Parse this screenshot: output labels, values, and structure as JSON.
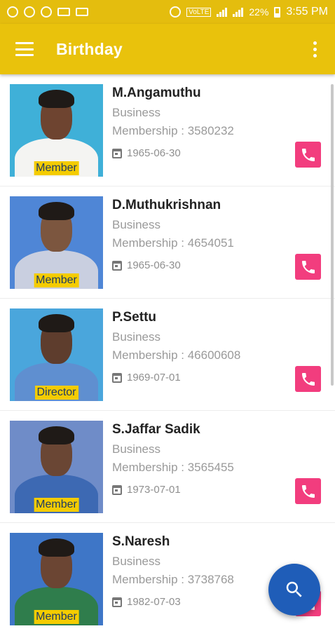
{
  "status_bar": {
    "battery": "22%",
    "time": "3:55 PM",
    "network": "VoLTE"
  },
  "app_bar": {
    "title": "Birthday",
    "menu_icon": "menu-icon",
    "overflow_icon": "more-vert-icon"
  },
  "colors": {
    "app_bar": "#e9c20c",
    "call_button": "#f23d7e",
    "fab": "#1f5db8",
    "role_tag": "#f4cc00"
  },
  "members": [
    {
      "name": "M.Angamuthu",
      "occupation": "Business",
      "membership": "Membership : 3580232",
      "dob": "1965-06-30",
      "role": "Member"
    },
    {
      "name": "D.Muthukrishnan",
      "occupation": "Business",
      "membership": "Membership : 4654051",
      "dob": "1965-06-30",
      "role": "Member"
    },
    {
      "name": "P.Settu",
      "occupation": "Business",
      "membership": "Membership : 46600608",
      "dob": "1969-07-01",
      "role": "Director"
    },
    {
      "name": "S.Jaffar Sadik",
      "occupation": "Business",
      "membership": "Membership : 3565455",
      "dob": "1973-07-01",
      "role": "Member"
    },
    {
      "name": "S.Naresh",
      "occupation": "Business",
      "membership": "Membership : 3738768",
      "dob": "1982-07-03",
      "role": "Member"
    }
  ],
  "fab": {
    "icon": "search-icon"
  }
}
